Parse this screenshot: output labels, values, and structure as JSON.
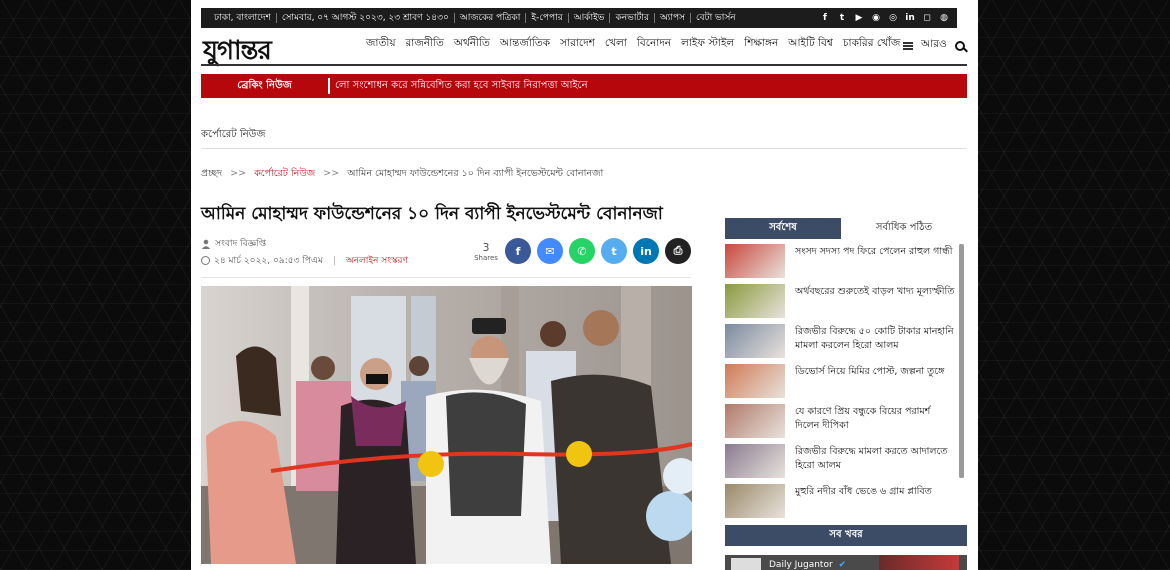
{
  "topbar": {
    "links": [
      "ঢাকা, বাংলাদেশ",
      "সোমবার, ০৭ আগস্ট ২০২৩, ২৩ শ্রাবণ ১৪৩০",
      "আজকের পত্রিকা",
      "ই-পেপার",
      "আর্কাইভ",
      "কনভার্টার",
      "অ্যাপস",
      "বেটা ভার্সন"
    ],
    "social": [
      "f",
      "t",
      "▶",
      "◉",
      "◎",
      "in",
      "◻",
      "◍"
    ]
  },
  "logo": "যুগান্তর",
  "nav": {
    "items": [
      "জাতীয়",
      "রাজনীতি",
      "অর্থনীতি",
      "আন্তর্জাতিক",
      "সারাদেশ",
      "খেলা",
      "বিনোদন",
      "লাইফ স্টাইল",
      "শিক্ষাঙ্গন",
      "আইটি বিশ্ব",
      "চাকরির খোঁজ"
    ],
    "more": "আরও"
  },
  "breaking": {
    "label": "ব্রেকিং নিউজ",
    "text": "লো সংশোধন করে সন্নিবেশিত করা হবে সাইবার নিরাপত্তা আইনে"
  },
  "section": "কর্পোরেট নিউজ",
  "breadcrumb": {
    "home": "প্রচ্ছদ",
    "sep": ">>",
    "category": "কর্পোরেট নিউজ",
    "current": "আমিন মোহাম্মদ ফাউন্ডেশনের ১০ দিন ব্যাপী ইনভেস্টমেন্ট বোনানজা"
  },
  "article": {
    "title": "আমিন মোহাম্মদ ফাউন্ডেশনের ১০ দিন ব্যাপী ইনভেস্টমেন্ট বোনানজা",
    "author": "সংবাদ বিজ্ঞপ্তি",
    "date": "২৪ মার্চ ২০২২, ০৯:৫৩ পিএম",
    "edition": "অনলাইন সংস্করণ",
    "shares_count": "3",
    "shares_label": "Shares",
    "share_buttons": [
      {
        "icon": "facebook-icon",
        "glyph": "f",
        "color": "#3b5998"
      },
      {
        "icon": "messenger-icon",
        "glyph": "✉",
        "color": "#448aff"
      },
      {
        "icon": "whatsapp-icon",
        "glyph": "✆",
        "color": "#25d366"
      },
      {
        "icon": "twitter-icon",
        "glyph": "t",
        "color": "#55acee"
      },
      {
        "icon": "linkedin-icon",
        "glyph": "in",
        "color": "#0077b5"
      },
      {
        "icon": "print-icon",
        "glyph": "⎙",
        "color": "#222222"
      }
    ]
  },
  "sidebar": {
    "tab_latest": "সর্বশেষ",
    "tab_most_read": "সর্বাধিক পঠিত",
    "news": [
      {
        "title": "সংসদ সদস্য পদ ফিরে পেলেন রাহুল গান্ধী",
        "thumb": "#c9473d"
      },
      {
        "title": "অর্থবছরের শুরুতেই বাড়ল খাদ্য মূল্যস্ফীতি",
        "thumb": "#8a9a3d"
      },
      {
        "title": "রিজভীর বিরুদ্ধে ৫০ কোটি টাকার মানহানি মামলা করলেন হিরো আলম",
        "thumb": "#7b8aa0"
      },
      {
        "title": "ডিভোর্স নিয়ে মিমির পোস্ট, জল্পনা তুঙ্গে",
        "thumb": "#d07a55"
      },
      {
        "title": "যে কারণে প্রিয় বন্ধুকে বিয়ের পরামর্শ দিলেন দীপিকা",
        "thumb": "#b07a6a"
      },
      {
        "title": "রিজভীর বিরুদ্ধে মামলা করতে আদালতে হিরো আলম",
        "thumb": "#8a7b90"
      },
      {
        "title": "মুহুরি নদীর বাঁধ ভেঙে ৬ গ্রাম প্লাবিত",
        "thumb": "#9a8a6a"
      }
    ],
    "all_news": "সব খবর",
    "fb_page": "Daily Jugantor"
  }
}
